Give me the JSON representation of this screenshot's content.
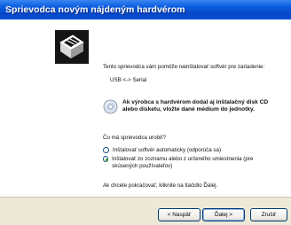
{
  "window": {
    "title": "Sprievodca novým nájdeným hardvérom"
  },
  "wizard": {
    "intro": "Tento sprievodca vám pomôže nainštalovať softvér pre zariadenie:",
    "device": "USB <-> Serial",
    "cd_notice": "Ak výrobca s hardvérom dodal aj inštalačný disk CD alebo disketu, vložte dané médium do jednotky.",
    "question": "Čo má sprievodca urobiť?",
    "options": [
      {
        "label": "Inštalovať softvér automaticky (odporúča sa)",
        "selected": false
      },
      {
        "label": "Inštalovať zo zoznamu alebo z určeného umiestnenia (pre skúsených používateľov)",
        "selected": true
      }
    ],
    "continue_hint": "Ak chcete pokračovať, kliknite na tlačidlo Ďalej."
  },
  "buttons": {
    "back": "< Naspäť",
    "next": "Ďalej >",
    "cancel": "Zrušiť"
  },
  "colors": {
    "title_bar": "#0a5ee0",
    "radio_dot": "#21a121"
  }
}
